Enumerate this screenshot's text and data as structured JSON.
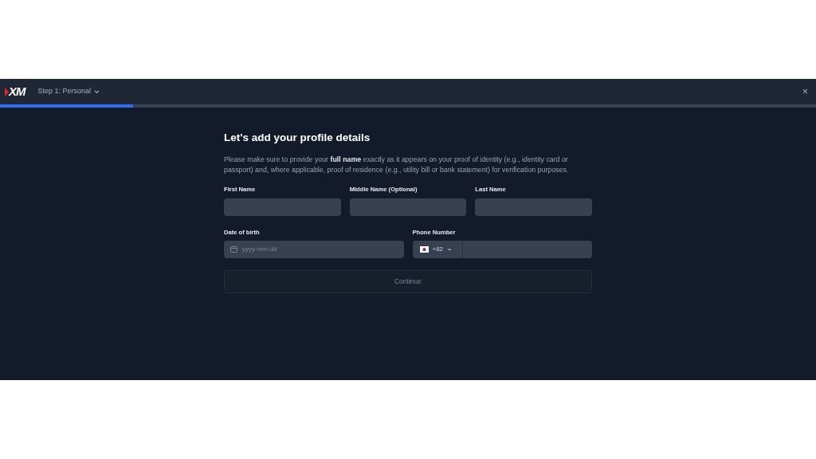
{
  "header": {
    "logo": "XM",
    "step": "Step 1: Personal",
    "close": "×"
  },
  "progress": {
    "level": 0.163
  },
  "form": {
    "title": "Let's add your profile details",
    "intro": "Please make sure to provide your **full name** exactly as it appears on your proof of identity (e.g., identity card or passport) and, where applicable, proof of residence (e.g., utility bill or bank statement) for verification purposes.",
    "rows": [
      [
        {
          "kind": "text",
          "label": "First Name"
        },
        {
          "kind": "text",
          "label": "Middle Name (Optional)"
        },
        {
          "kind": "text",
          "label": "Last Name"
        }
      ],
      [
        {
          "kind": "date",
          "label": "Date of birth",
          "placeholder": "yyyy-mm-dd"
        },
        {
          "kind": "phone",
          "label": "Phone Number",
          "code": "+82"
        }
      ]
    ],
    "button": {
      "label": "Continue",
      "disabled": true
    }
  }
}
